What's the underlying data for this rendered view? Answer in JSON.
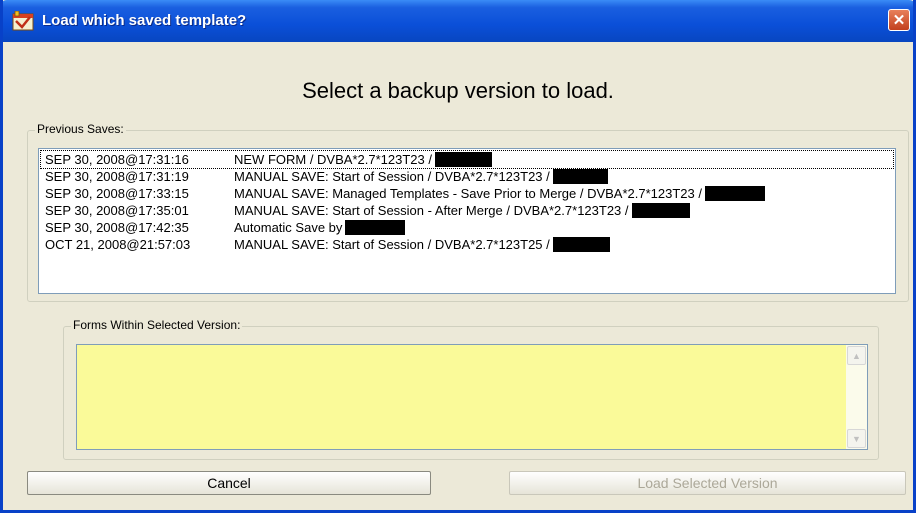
{
  "window": {
    "title": "Load which saved template?",
    "close_symbol": "✕"
  },
  "heading": "Select a backup version to load.",
  "previous_saves": {
    "label": "Previous Saves:",
    "items": [
      {
        "date": "SEP 30, 2008@17:31:16",
        "description": "NEW FORM / DVBA*2.7*123T23 /",
        "selected": true
      },
      {
        "date": "SEP 30, 2008@17:31:19",
        "description": "MANUAL SAVE:  Start of Session / DVBA*2.7*123T23 /",
        "selected": false
      },
      {
        "date": "SEP 30, 2008@17:33:15",
        "description": "MANUAL SAVE:  Managed Templates - Save Prior to Merge / DVBA*2.7*123T23 /",
        "selected": false
      },
      {
        "date": "SEP 30, 2008@17:35:01",
        "description": "MANUAL SAVE:  Start of Session - After Merge / DVBA*2.7*123T23 /",
        "selected": false
      },
      {
        "date": "SEP 30, 2008@17:42:35",
        "description": "Automatic Save by",
        "selected": false
      },
      {
        "date": "OCT 21, 2008@21:57:03",
        "description": "MANUAL SAVE:  Start of Session / DVBA*2.7*123T25 /",
        "selected": false
      }
    ]
  },
  "forms_within": {
    "label": "Forms Within Selected Version:",
    "value": ""
  },
  "buttons": {
    "cancel": "Cancel",
    "load": "Load Selected Version",
    "load_enabled": false
  },
  "colors": {
    "titlebar": "#0a4fd8",
    "dialog_bg": "#ece9d8",
    "forms_bg": "#fafa99",
    "disabled_text": "#aca899"
  }
}
